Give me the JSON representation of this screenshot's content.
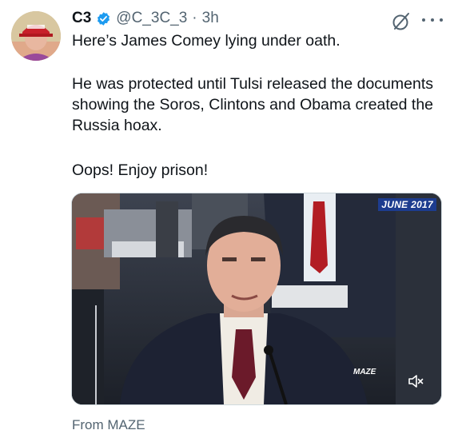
{
  "author": {
    "name": "C3",
    "handle": "@C_3C_3",
    "separator": "·",
    "time": "3h"
  },
  "icons": {
    "verified": "verified-badge-icon",
    "grok": "grok-icon",
    "more": "more-options-icon",
    "mute": "muted-speaker-icon"
  },
  "tweet": {
    "paragraph1": "Here’s James Comey lying under oath.",
    "paragraph2": "He was protected until Tulsi released the documents showing the Soros, Clintons and Obama created the Russia hoax.",
    "paragraph3": "Oops! Enjoy prison!"
  },
  "media": {
    "date_badge": "JUNE 2017",
    "watermark": "MAZE"
  },
  "source": "From MAZE",
  "colors": {
    "verified_blue": "#1d9bf0",
    "secondary_text": "#536471",
    "badge_blue": "#1d3c8f"
  }
}
